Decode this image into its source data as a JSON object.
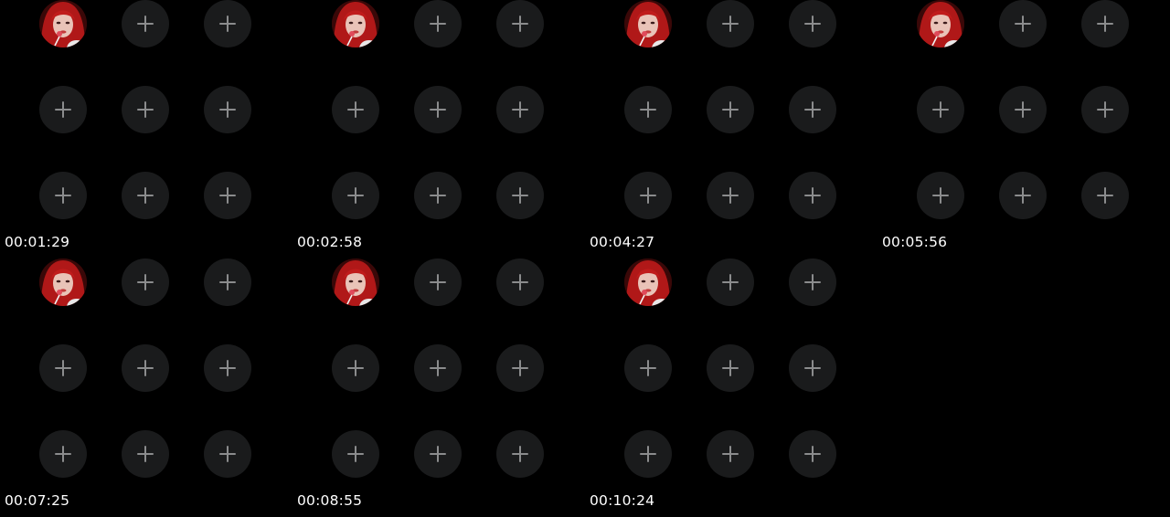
{
  "frames": [
    {
      "timestamp": "00:01:29"
    },
    {
      "timestamp": "00:02:58"
    },
    {
      "timestamp": "00:04:27"
    },
    {
      "timestamp": "00:05:56"
    },
    {
      "timestamp": "00:07:25"
    },
    {
      "timestamp": "00:08:55"
    },
    {
      "timestamp": "00:10:24"
    }
  ],
  "icons": {
    "add": "plus-icon",
    "profile": "avatar"
  },
  "colors": {
    "background": "#000000",
    "slot": "#1a1b1c",
    "plus": "#8b8c8d",
    "timestamp": "#ffffff",
    "hair": "#b01818"
  }
}
